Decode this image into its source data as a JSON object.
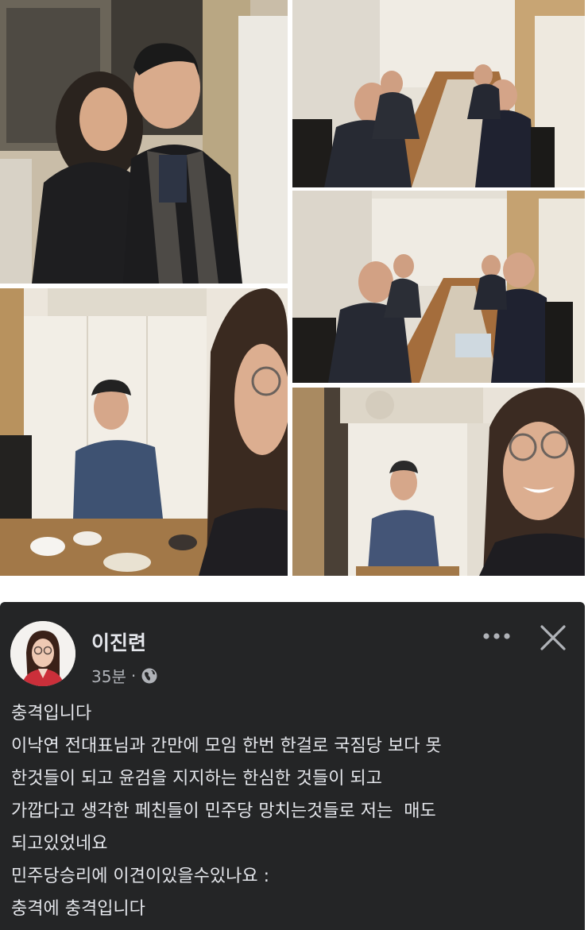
{
  "post": {
    "author": "이진련",
    "time": "35분",
    "separator": "·",
    "lines": [
      "충격입니다",
      "이낙연 전대표님과 간만에 모임 한번 한걸로 국짐당 보다 못",
      "한것들이 되고 윤검을 지지하는 한심한 것들이 되고",
      "가깝다고 생각한 페친들이 민주당 망치는것들로 저는  매도",
      "되고있었네요",
      "민주당승리에 이견이있을수있나요 :",
      "충격에 충격입니다"
    ]
  },
  "icons": {
    "more": "more-horizontal-icon",
    "close": "close-icon",
    "audience": "globe-icon"
  },
  "colors": {
    "post_background": "#242526",
    "primary_text": "#e4e6eb",
    "secondary_text": "#b0b3b8"
  }
}
